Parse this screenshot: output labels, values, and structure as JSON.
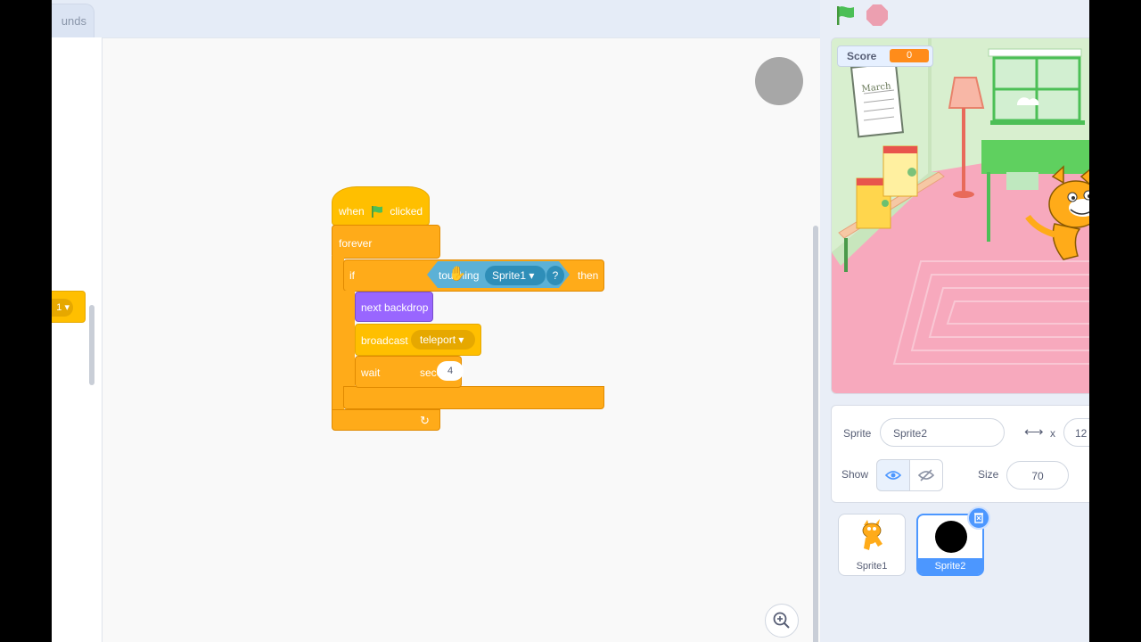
{
  "tabs": {
    "sounds_partial": "unds"
  },
  "palette": {
    "block_value": "1"
  },
  "script": {
    "hat_when": "when",
    "hat_clicked": "clicked",
    "forever": "forever",
    "if_label": "if",
    "then_label": "then",
    "touching": "touching",
    "touching_target": "Sprite1",
    "question": "?",
    "next_backdrop": "next backdrop",
    "broadcast": "broadcast",
    "broadcast_message": "teleport",
    "wait": "wait",
    "wait_value": "4",
    "seconds": "seconds"
  },
  "stage": {
    "score_label": "Score",
    "score_value": "0",
    "calendar_text": "March"
  },
  "sprite_info": {
    "sprite_label": "Sprite",
    "sprite_name": "Sprite2",
    "x_label": "x",
    "x_value": "12",
    "show_label": "Show",
    "size_label": "Size",
    "size_value": "70"
  },
  "sprites": [
    {
      "name": "Sprite1",
      "selected": false
    },
    {
      "name": "Sprite2",
      "selected": true
    }
  ],
  "colors": {
    "events": "#ffbf00",
    "control": "#ffab19",
    "sensing": "#5cb1d6",
    "looks": "#9966ff",
    "selected": "#4c97ff"
  }
}
